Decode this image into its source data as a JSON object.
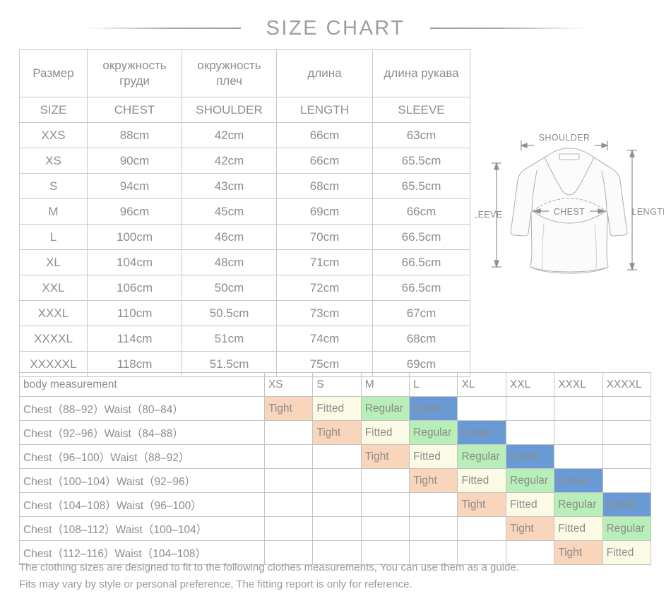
{
  "title": "SIZE CHART",
  "size_table": {
    "headers_ru": [
      "Размер",
      "окружность груди",
      "окружность плеч",
      "длина",
      "длина рукава"
    ],
    "headers_en": [
      "SIZE",
      "CHEST",
      "SHOULDER",
      "LENGTH",
      "SLEEVE"
    ],
    "rows": [
      {
        "size": "XXS",
        "chest": "88cm",
        "shoulder": "42cm",
        "length": "66cm",
        "sleeve": "63cm"
      },
      {
        "size": "XS",
        "chest": "90cm",
        "shoulder": "42cm",
        "length": "66cm",
        "sleeve": "65.5cm"
      },
      {
        "size": "S",
        "chest": "94cm",
        "shoulder": "43cm",
        "length": "68cm",
        "sleeve": "65.5cm"
      },
      {
        "size": "M",
        "chest": "96cm",
        "shoulder": "45cm",
        "length": "69cm",
        "sleeve": "66cm"
      },
      {
        "size": "L",
        "chest": "100cm",
        "shoulder": "46cm",
        "length": "70cm",
        "sleeve": "66.5cm"
      },
      {
        "size": "XL",
        "chest": "104cm",
        "shoulder": "48cm",
        "length": "71cm",
        "sleeve": "66.5cm"
      },
      {
        "size": "XXL",
        "chest": "106cm",
        "shoulder": "50cm",
        "length": "72cm",
        "sleeve": "66.5cm"
      },
      {
        "size": "XXXL",
        "chest": "110cm",
        "shoulder": "50.5cm",
        "length": "73cm",
        "sleeve": "67cm"
      },
      {
        "size": "XXXXL",
        "chest": "114cm",
        "shoulder": "51cm",
        "length": "74cm",
        "sleeve": "68cm"
      },
      {
        "size": "XXXXXL",
        "chest": "118cm",
        "shoulder": "51.5cm",
        "length": "75cm",
        "sleeve": "69cm"
      }
    ]
  },
  "diagram": {
    "labels": {
      "shoulder": "SHOULDER",
      "chest": "CHEST",
      "sleeve": "SLEEVE",
      "length": "LENGTH"
    }
  },
  "fit_table": {
    "measurement_header": "body measurement",
    "size_columns": [
      "XS",
      "S",
      "M",
      "L",
      "XL",
      "XXL",
      "XXXL",
      "XXXXL"
    ],
    "fit_colors": {
      "Tight": "#f9d5bb",
      "Fitted": "#fbfbe5",
      "Regular": "#b8eeb8",
      "Loose": "#6a9ad4"
    },
    "rows": [
      {
        "measurement": "Chest（88–92）Waist（80–84）",
        "fits": [
          "Tight",
          "Fitted",
          "Regular",
          "Loose",
          "",
          "",
          "",
          ""
        ]
      },
      {
        "measurement": "Chest（92–96）Waist（84–88）",
        "fits": [
          "",
          "Tight",
          "Fitted",
          "Regular",
          "Loose",
          "",
          "",
          ""
        ]
      },
      {
        "measurement": "Chest（96–100）Waist（88–92）",
        "fits": [
          "",
          "",
          "Tight",
          "Fitted",
          "Regular",
          "Loose",
          "",
          ""
        ]
      },
      {
        "measurement": "Chest（100–104）Waist（92–96）",
        "fits": [
          "",
          "",
          "",
          "Tight",
          "Fitted",
          "Regular",
          "Loose",
          ""
        ]
      },
      {
        "measurement": "Chest（104–108）Waist（96–100）",
        "fits": [
          "",
          "",
          "",
          "",
          "Tight",
          "Fitted",
          "Regular",
          "Loose"
        ]
      },
      {
        "measurement": "Chest（108–112）Waist（100–104）",
        "fits": [
          "",
          "",
          "",
          "",
          "",
          "Tight",
          "Fitted",
          "Regular"
        ]
      },
      {
        "measurement": "Chest（112–116）Waist（104–108）",
        "fits": [
          "",
          "",
          "",
          "",
          "",
          "",
          "Tight",
          "Fitted"
        ]
      }
    ]
  },
  "footer": {
    "line1": "The clothing sizes are designed to fit to the following clothes measurements, You can use them as a guide.",
    "line2": "Fits may vary by style or personal preference, The fitting report is only for reference."
  }
}
